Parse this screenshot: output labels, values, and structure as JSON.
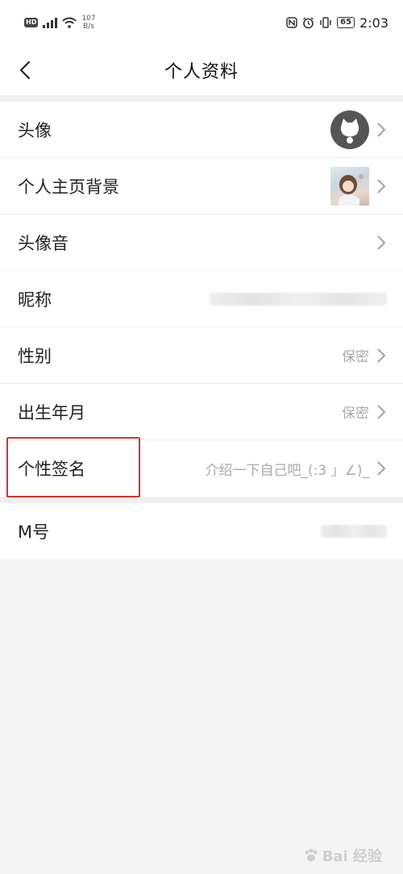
{
  "status_bar": {
    "hd": "HD",
    "network_speed_value": "107",
    "network_speed_unit": "B/s",
    "battery": "65",
    "time": "2:03"
  },
  "nav": {
    "title": "个人资料"
  },
  "profile_rows": [
    {
      "label": "头像"
    },
    {
      "label": "个人主页背景"
    },
    {
      "label": "头像音"
    },
    {
      "label": "昵称"
    },
    {
      "label": "性别",
      "value": "保密"
    },
    {
      "label": "出生年月",
      "value": "保密"
    },
    {
      "label": "个性签名",
      "value": "介绍一下自己吧_(:3 」∠)_"
    }
  ],
  "account_row": {
    "label": "M号"
  },
  "watermark": {
    "text": "Bai 经验"
  },
  "colors": {
    "highlight": "#d8322c",
    "background": "#f4f4f4"
  }
}
